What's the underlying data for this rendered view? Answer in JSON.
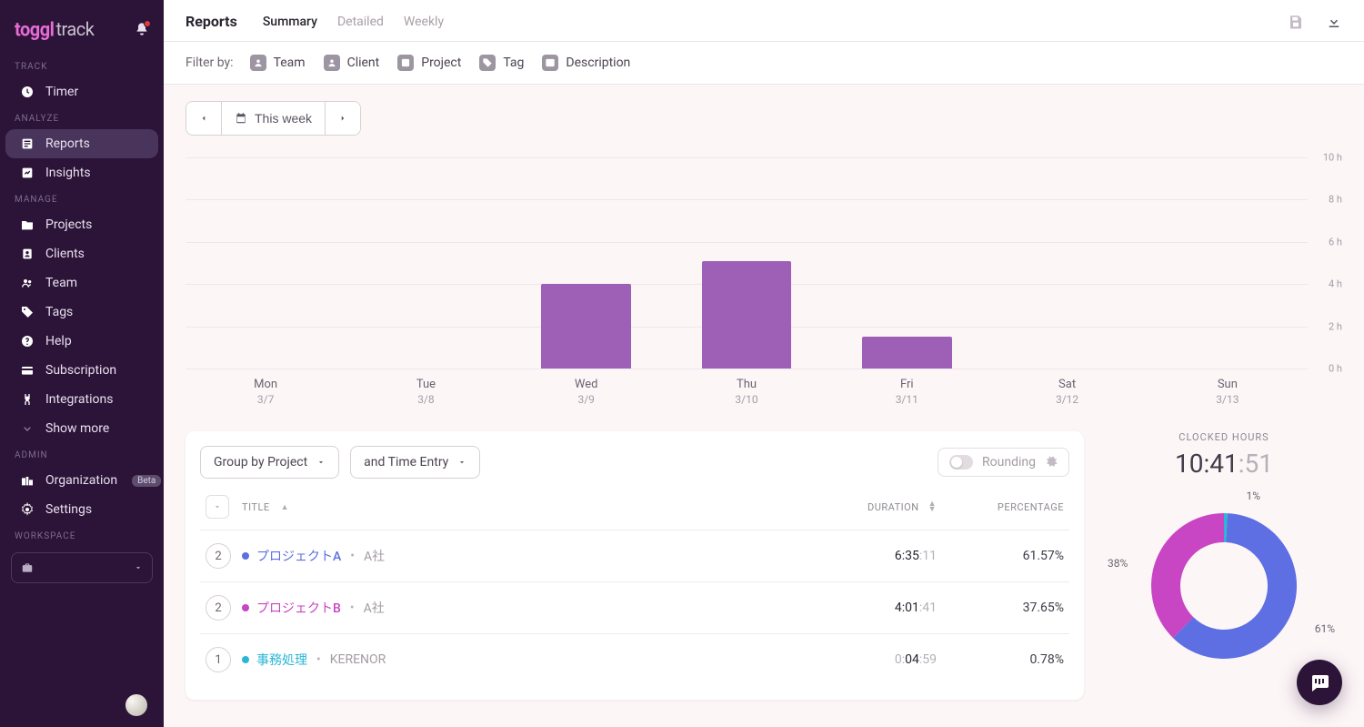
{
  "brand": {
    "a": "toggl",
    "b": "track"
  },
  "sidebar": {
    "sections": [
      {
        "label": "TRACK",
        "items": [
          {
            "id": "timer",
            "label": "Timer"
          }
        ]
      },
      {
        "label": "ANALYZE",
        "items": [
          {
            "id": "reports",
            "label": "Reports",
            "active": true
          },
          {
            "id": "insights",
            "label": "Insights"
          }
        ]
      },
      {
        "label": "MANAGE",
        "items": [
          {
            "id": "projects",
            "label": "Projects"
          },
          {
            "id": "clients",
            "label": "Clients"
          },
          {
            "id": "team",
            "label": "Team"
          },
          {
            "id": "tags",
            "label": "Tags"
          },
          {
            "id": "help",
            "label": "Help"
          },
          {
            "id": "subscription",
            "label": "Subscription"
          },
          {
            "id": "integrations",
            "label": "Integrations"
          },
          {
            "id": "showmore",
            "label": "Show more"
          }
        ]
      },
      {
        "label": "ADMIN",
        "items": [
          {
            "id": "organization",
            "label": "Organization",
            "badge": "Beta"
          },
          {
            "id": "settings",
            "label": "Settings"
          }
        ]
      }
    ],
    "workspace_label": "WORKSPACE"
  },
  "header": {
    "title": "Reports",
    "tabs": [
      {
        "id": "summary",
        "label": "Summary",
        "active": true
      },
      {
        "id": "detailed",
        "label": "Detailed"
      },
      {
        "id": "weekly",
        "label": "Weekly"
      }
    ]
  },
  "filters": {
    "label": "Filter by:",
    "items": [
      {
        "id": "team",
        "label": "Team"
      },
      {
        "id": "client",
        "label": "Client"
      },
      {
        "id": "project",
        "label": "Project"
      },
      {
        "id": "tag",
        "label": "Tag"
      },
      {
        "id": "description",
        "label": "Description"
      }
    ]
  },
  "date_range": {
    "label": "This week"
  },
  "chart_data": {
    "type": "bar",
    "categories": [
      "Mon",
      "Tue",
      "Wed",
      "Thu",
      "Fri",
      "Sat",
      "Sun"
    ],
    "dates": [
      "3/7",
      "3/8",
      "3/9",
      "3/10",
      "3/11",
      "3/12",
      "3/13"
    ],
    "values": [
      0,
      0,
      4.0,
      5.1,
      1.5,
      0,
      0
    ],
    "ylim": [
      0,
      10
    ],
    "yticks": [
      "10 h",
      "8 h",
      "6 h",
      "4 h",
      "2 h",
      "0 h"
    ]
  },
  "group": {
    "primary": "Group by Project",
    "secondary": "and Time Entry"
  },
  "rounding_label": "Rounding",
  "table": {
    "headers": {
      "title": "TITLE",
      "duration": "DURATION",
      "percentage": "PERCENTAGE"
    },
    "rows": [
      {
        "count": "2",
        "color": "#5d6fe3",
        "name": "プロジェクトA",
        "client": "A社",
        "dur_main": "6:35",
        "dur_sec": ":11",
        "pct": "61.57%"
      },
      {
        "count": "2",
        "color": "#c845c3",
        "name": "プロジェクトB",
        "client": "A社",
        "dur_main": "4:01",
        "dur_sec": ":41",
        "pct": "37.65%"
      },
      {
        "count": "1",
        "color": "#2ab6d6",
        "name": "事務処理",
        "client": "KERENOR",
        "dur_pre": "0:",
        "dur_main": "04",
        "dur_sec": ":59",
        "pct": "0.78%"
      }
    ]
  },
  "clocked": {
    "label": "CLOCKED HOURS",
    "main": "10:41",
    "sec": ":51"
  },
  "donut": {
    "segments": [
      {
        "label": "61%",
        "pct": 61.57,
        "color": "#5d6fe3"
      },
      {
        "label": "38%",
        "pct": 37.65,
        "color": "#c845c3"
      },
      {
        "label": "1%",
        "pct": 0.78,
        "color": "#2ab6d6"
      }
    ]
  }
}
